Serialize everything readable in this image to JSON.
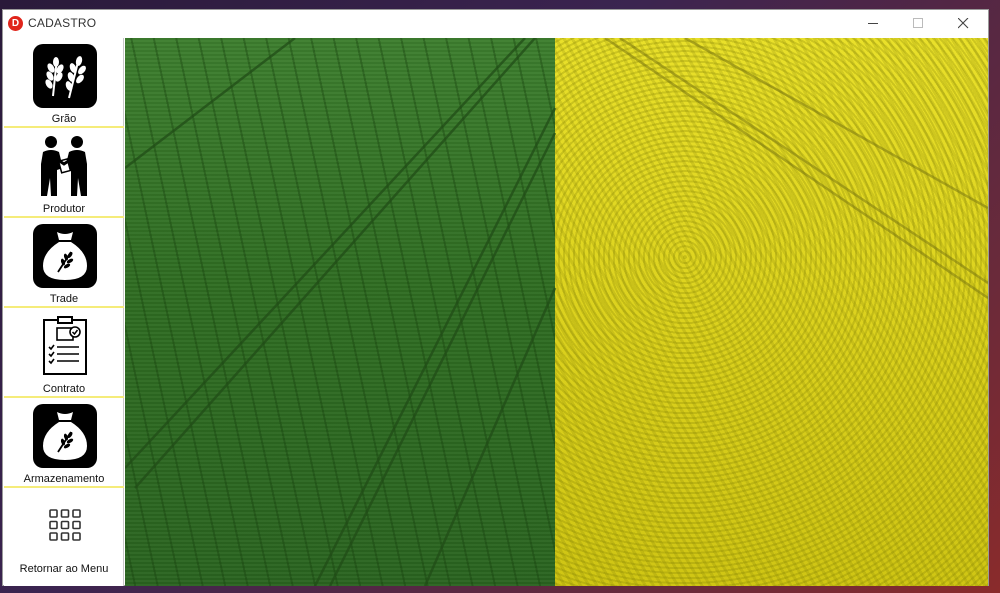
{
  "window": {
    "title": "CADASTRO",
    "app_icon_glyph": "D",
    "colors": {
      "app_icon": "#e0251b",
      "nav_divider": "#f5ec7a"
    }
  },
  "sidebar": {
    "items": [
      {
        "label": "Grão",
        "icon": "wheat-icon"
      },
      {
        "label": "Produtor",
        "icon": "handshake-icon"
      },
      {
        "label": "Trade",
        "icon": "grain-sack-icon"
      },
      {
        "label": "Contrato",
        "icon": "contract-icon"
      },
      {
        "label": "Armazenamento",
        "icon": "grain-sack-icon"
      },
      {
        "label": "Retornar ao Menu",
        "icon": "grid-menu-icon"
      }
    ]
  },
  "main": {
    "image": "green-and-yellow-crop-field"
  }
}
